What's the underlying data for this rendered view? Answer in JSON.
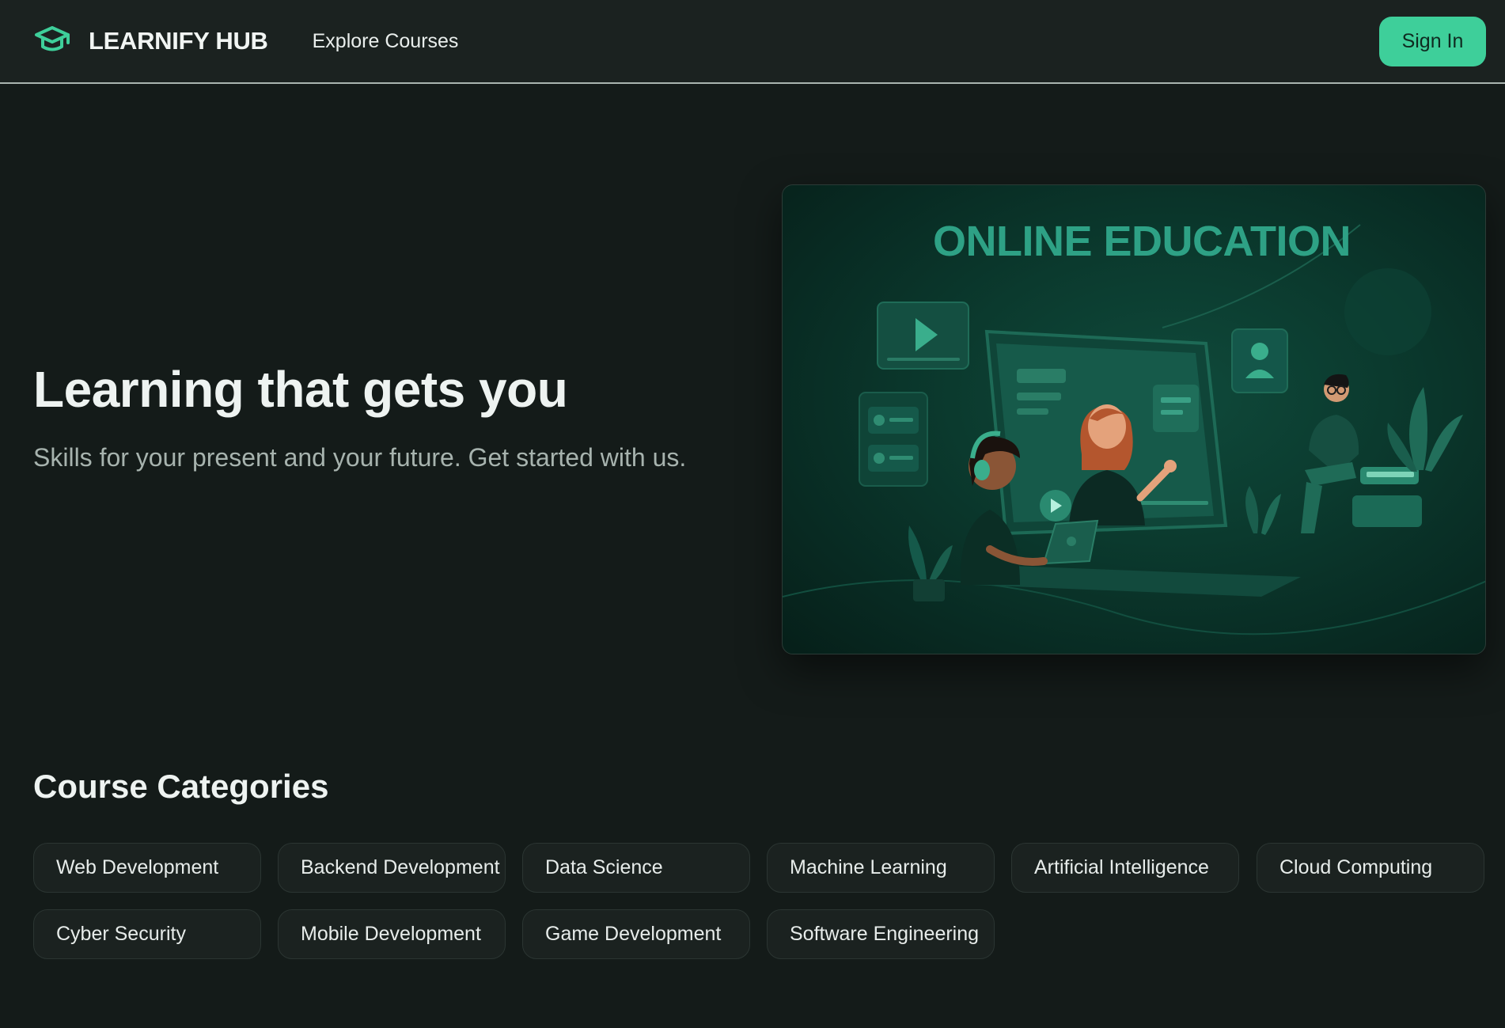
{
  "header": {
    "brand": "LEARNIFY HUB",
    "brand_icon": "graduation-cap-icon",
    "nav_link": "Explore Courses",
    "sign_in": "Sign In"
  },
  "hero": {
    "title": "Learning that gets you",
    "subtitle": "Skills for your present and your future. Get started with us.",
    "image_title": "ONLINE EDUCATION"
  },
  "categories": {
    "title": "Course Categories",
    "items": [
      "Web Development",
      "Backend Development",
      "Data Science",
      "Machine Learning",
      "Artificial Intelligence",
      "Cloud Computing",
      "Cyber Security",
      "Mobile Development",
      "Game Development",
      "Software Engineering"
    ]
  },
  "colors": {
    "background": "#141b19",
    "navbar": "#1b2220",
    "accent": "#3ecf9a",
    "image_title": "#2ea185"
  }
}
